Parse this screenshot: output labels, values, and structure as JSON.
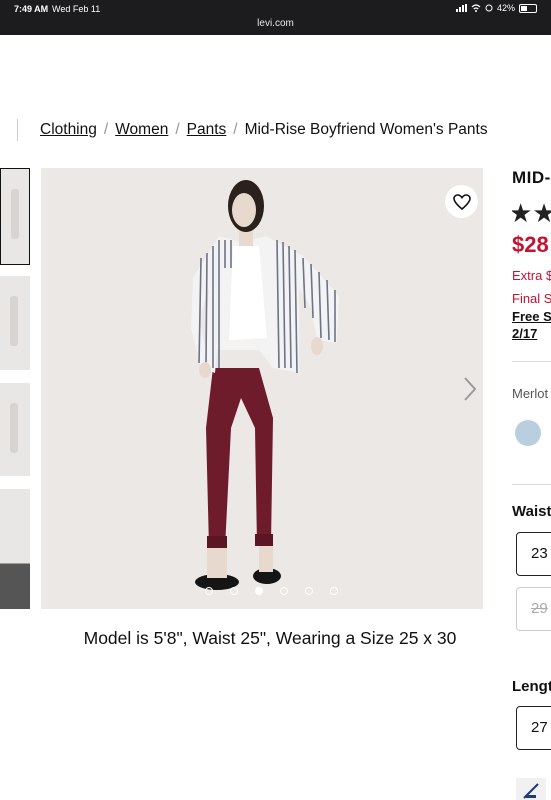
{
  "status_bar": {
    "time": "7:49 AM",
    "date": "Wed Feb 11",
    "battery": "42%",
    "url": "levi.com"
  },
  "breadcrumb": [
    "Clothing",
    "Women",
    "Pants",
    "Mid-Rise Boyfriend Women's Pants"
  ],
  "gallery": {
    "caption": "Model is 5'8\", Waist 25\", Wearing a Size 25 x 30",
    "dot_count": 6,
    "active_dot": 2
  },
  "product": {
    "title": "MID-",
    "price": "$28",
    "promo_line1": "Extra $",
    "promo_line2": "Final S",
    "shipping_line1": "Free S",
    "shipping_line2": "2/17",
    "color_name": "Merlot"
  },
  "waist": {
    "label": "Waist",
    "options": [
      "23",
      "29"
    ]
  },
  "length": {
    "label": "Lengt",
    "options": [
      "27"
    ]
  },
  "colors": {
    "price_red": "#c41230",
    "pants": "#6e1b2c",
    "swatch": "#b9cfe0"
  }
}
